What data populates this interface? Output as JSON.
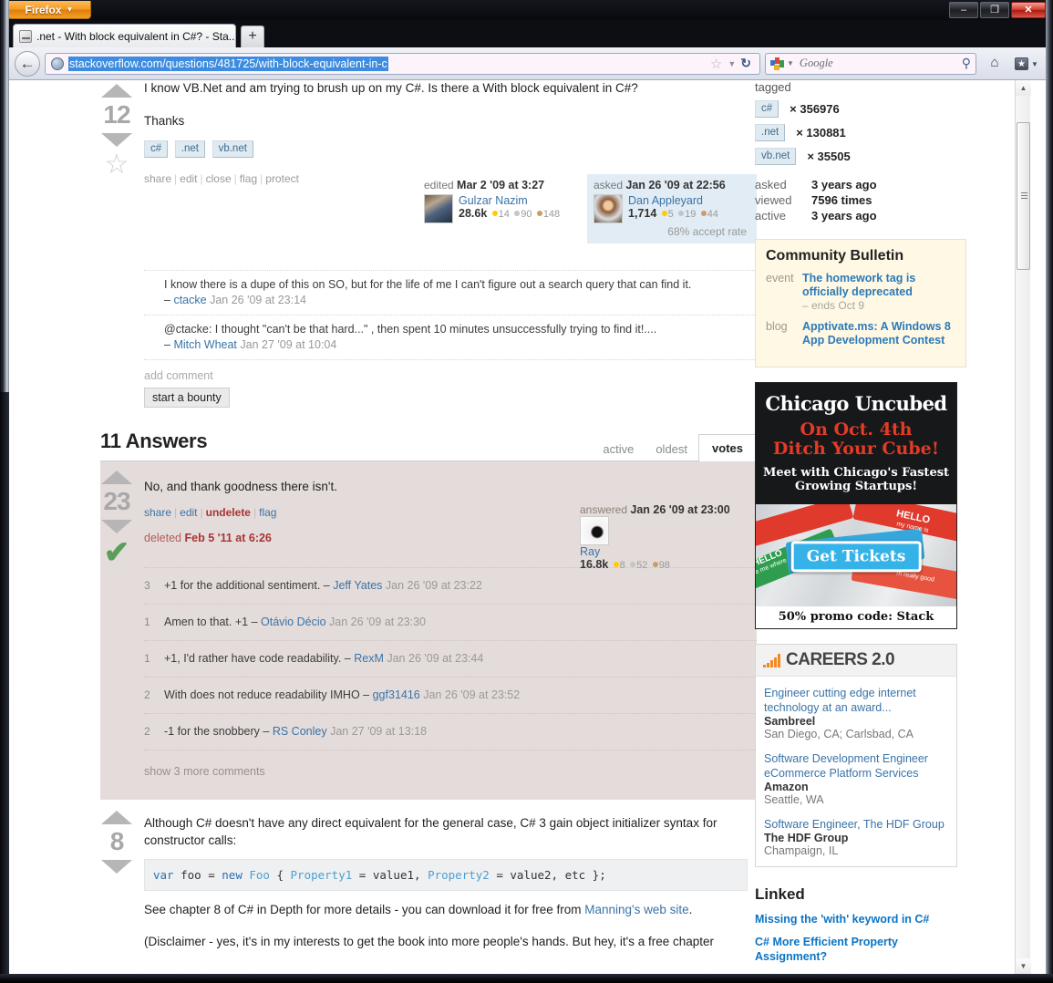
{
  "window": {
    "app_button": "Firefox",
    "minimize": "–",
    "maximize": "❐",
    "close": "✕"
  },
  "tabs": {
    "active_title": ".net - With block equivalent in C#? - Sta...",
    "new_tab": "+"
  },
  "toolbar": {
    "back": "←",
    "url": "stackoverflow.com/questions/481725/with-block-equivalent-in-c",
    "star": "☆",
    "star_caret": "▼",
    "reload": "↻",
    "search_placeholder": "Google",
    "search_caret": "▼",
    "search_magnifier": "⚲",
    "home": "⌂",
    "bookmarks": "★",
    "bookmarks_caret": "▼"
  },
  "scrollbar": {
    "up": "▲",
    "down": "▼"
  },
  "question": {
    "score": "12",
    "upvote": "upvote",
    "downvote": "downvote",
    "favorite": "☆",
    "body_line1": "I know VB.Net and am trying to brush up on my C#. Is there a With block equivalent in C#?",
    "body_line2": "Thanks",
    "tags": [
      "c#",
      ".net",
      "vb.net"
    ],
    "menu": [
      "share",
      "edit",
      "close",
      "flag",
      "protect"
    ],
    "edited": {
      "action": "edited",
      "date": "Mar 2 '09 at 3:27",
      "user": "Gulzar Nazim",
      "rep": "28.6k",
      "gold": "14",
      "silver": "90",
      "bronze": "148"
    },
    "asked": {
      "action": "asked",
      "date": "Jan 26 '09 at 22:56",
      "user": "Dan Appleyard",
      "rep": "1,714",
      "gold": "5",
      "silver": "19",
      "bronze": "44",
      "accept_rate": "68% accept rate"
    },
    "comments": [
      {
        "score": "",
        "text": "I know there is a dupe of this on SO, but for the life of me I can't figure out a search query that can find it.",
        "dash": "–",
        "user": "ctacke",
        "date": "Jan 26 '09 at 23:14"
      },
      {
        "score": "",
        "text": "@ctacke: I thought \"can't be that hard...\" , then spent 10 minutes unsuccessfully trying to find it!....",
        "dash": "–",
        "user": "Mitch Wheat",
        "date": "Jan 27 '09 at 10:04"
      }
    ],
    "add_comment": "add comment",
    "start_bounty": "start a bounty"
  },
  "answers_section": {
    "heading": "11 Answers",
    "sort_tabs": [
      {
        "label": "active",
        "active": false
      },
      {
        "label": "oldest",
        "active": false
      },
      {
        "label": "votes",
        "active": true
      }
    ]
  },
  "answer1": {
    "score": "23",
    "accepted_check": "✔",
    "body": "No, and thank goodness there isn't.",
    "menu": [
      "share",
      "edit",
      "undelete",
      "flag"
    ],
    "deleted_label": "deleted",
    "deleted_date": "Feb 5 '11 at 6:26",
    "answered": {
      "action": "answered",
      "date": "Jan 26 '09 at 23:00",
      "user": "Ray",
      "rep": "16.8k",
      "gold": "8",
      "silver": "52",
      "bronze": "98"
    },
    "comments": [
      {
        "score": "3",
        "text": "+1 for the additional sentiment.",
        "dash": "–",
        "user": "Jeff Yates",
        "date": "Jan 26 '09 at 23:22"
      },
      {
        "score": "1",
        "text": "Amen to that. +1",
        "dash": "–",
        "user": "Otávio Décio",
        "date": "Jan 26 '09 at 23:30"
      },
      {
        "score": "1",
        "text": "+1, I'd rather have code readability.",
        "dash": "–",
        "user": "RexM",
        "date": "Jan 26 '09 at 23:44"
      },
      {
        "score": "2",
        "text": "With does not reduce readability IMHO",
        "dash": "–",
        "user": "ggf31416",
        "date": "Jan 26 '09 at 23:52"
      },
      {
        "score": "2",
        "text": "-1 for the snobbery",
        "dash": "–",
        "user": "RS Conley",
        "date": "Jan 27 '09 at 13:18"
      }
    ],
    "show_more": "show 3 more comments"
  },
  "answer2": {
    "score": "8",
    "para1": "Although C# doesn't have any direct equivalent for the general case, C# 3 gain object initializer syntax for constructor calls:",
    "code": "var foo = new Foo { Property1 = value1, Property2 = value2, etc };",
    "para2_before": "See chapter 8 of C# in Depth for more details - you can download it for free from ",
    "para2_link": "Manning's web site",
    "para2_after": ".",
    "para3": "(Disclaimer - yes, it's in my interests to get the book into more people's hands. But hey, it's a free chapter"
  },
  "sidebar": {
    "tagged_title": "tagged",
    "tags": [
      {
        "name": "c#",
        "count": "× 356976"
      },
      {
        "name": ".net",
        "count": "× 130881"
      },
      {
        "name": "vb.net",
        "count": "× 35505"
      }
    ],
    "stats": [
      {
        "label": "asked",
        "value": "3 years ago"
      },
      {
        "label": "viewed",
        "value": "7596 times"
      },
      {
        "label": "active",
        "value": "3 years ago"
      }
    ],
    "bulletin": {
      "title": "Community Bulletin",
      "items": [
        {
          "kind": "event",
          "text": "The homework tag is officially deprecated",
          "ends": "– ends Oct 9"
        },
        {
          "kind": "blog",
          "text": "Apptivate.ms: A Windows 8 App Development Contest",
          "ends": ""
        }
      ]
    },
    "ad": {
      "line1": "Chicago Uncubed",
      "line2a": "On Oct. 4th",
      "line2b": "Ditch Your Cube!",
      "line3": "Meet with Chicago's Fastest Growing Startups!",
      "cta": "Get Tickets",
      "footer": "50% promo code: Stack",
      "nametags": [
        "HELLO",
        "HELLO",
        "HELLO",
        "my name is",
        "like me where",
        "m really good"
      ]
    },
    "careers": {
      "title": "CAREERS 2.0",
      "jobs": [
        {
          "title": "Engineer cutting edge internet technology at an award...",
          "company": "Sambreel",
          "location": "San Diego, CA; Carlsbad, CA"
        },
        {
          "title": "Software Development Engineer eCommerce Platform Services",
          "company": "Amazon",
          "location": "Seattle, WA"
        },
        {
          "title": "Software Engineer, The HDF Group",
          "company": "The HDF Group",
          "location": "Champaign, IL"
        }
      ]
    },
    "linked": {
      "title": "Linked",
      "items": [
        "Missing the 'with' keyword in C#",
        "C# More Efficient Property Assignment?"
      ]
    }
  },
  "colors": {
    "accent_blue": "#3a73a8",
    "owner_box": "#e1ecf4",
    "deleted_bg": "#e4dcda",
    "bulletin_bg": "#fef8e4",
    "gold": "#ffcc01",
    "silver": "#c5c5c5",
    "bronze": "#cc9b66",
    "firefox_orange": "#f59a23",
    "ad_red": "#e23b26"
  }
}
